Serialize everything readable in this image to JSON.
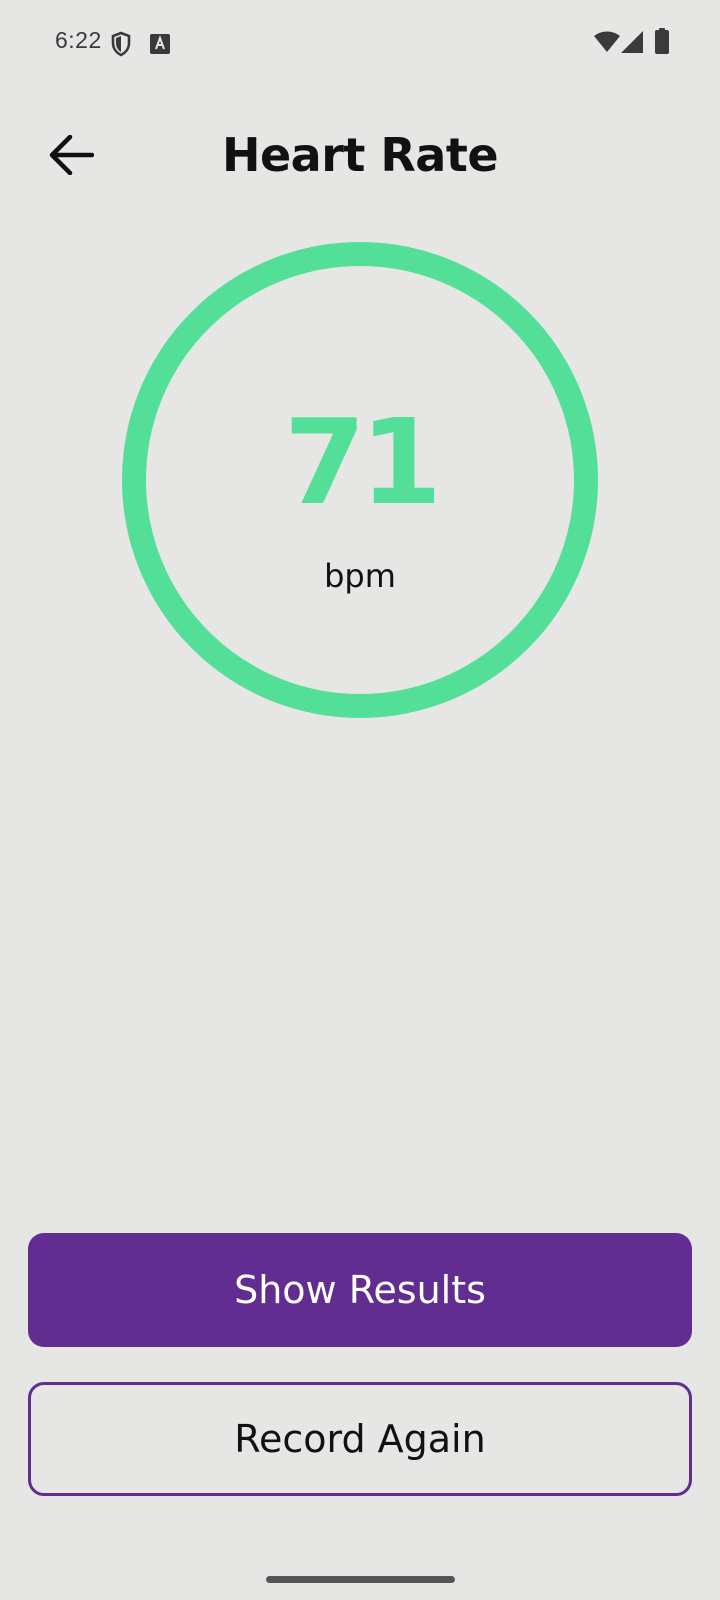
{
  "status_bar": {
    "time": "6:22",
    "left_icons": [
      "shield-icon",
      "text-a-icon"
    ],
    "right_icons": [
      "wifi-icon",
      "cell-signal-icon",
      "battery-icon"
    ]
  },
  "header": {
    "back_icon": "arrow-left-icon",
    "title": "Heart Rate"
  },
  "reading": {
    "value": "71",
    "unit": "bpm",
    "accent_color": "#53df98"
  },
  "actions": {
    "primary_label": "Show Results",
    "secondary_label": "Record Again",
    "brand_color": "#622d91"
  }
}
